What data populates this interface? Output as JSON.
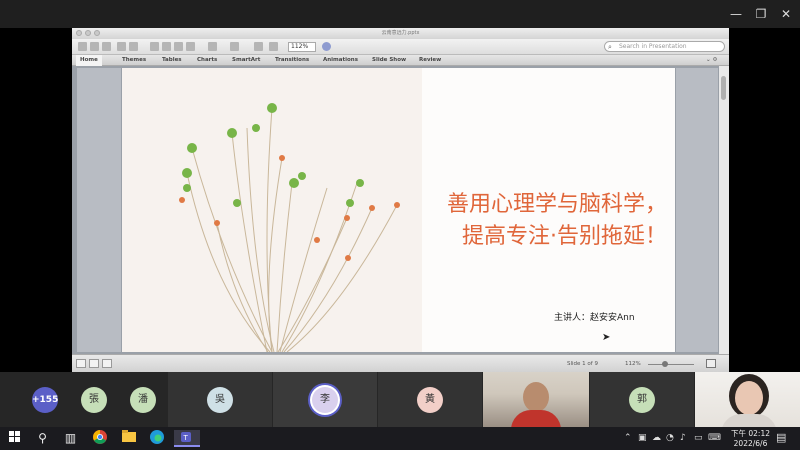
{
  "window": {
    "controls": {
      "minimize": "—",
      "maximize": "❐",
      "close": "✕"
    }
  },
  "ppt": {
    "title": "云南意远力.pptx",
    "zoom": "112%",
    "search_placeholder": "Search in Presentation",
    "ribbon_tabs": [
      "Home",
      "Themes",
      "Tables",
      "Charts",
      "SmartArt",
      "Transitions",
      "Animations",
      "Slide Show",
      "Review"
    ],
    "slide": {
      "title_line1": "善用心理学与脑科学，",
      "title_line2": "提高专注·告别拖延！",
      "speaker": "主讲人：赵安安Ann"
    },
    "status": {
      "slide_number": "Slide 1 of 9",
      "zoom": "112%"
    },
    "colors": {
      "title_accent": "#e0663a"
    }
  },
  "gallery": {
    "overflow_count": "+155",
    "participants": [
      "張",
      "潘",
      "吳",
      "李",
      "黃",
      "郭"
    ]
  },
  "taskbar": {
    "time": "下午 02:12",
    "date": "2022/6/6",
    "icons": [
      "windows-start-icon",
      "search-icon",
      "task-view-icon",
      "chrome-icon",
      "file-explorer-icon",
      "edge-icon",
      "teams-icon"
    ]
  }
}
